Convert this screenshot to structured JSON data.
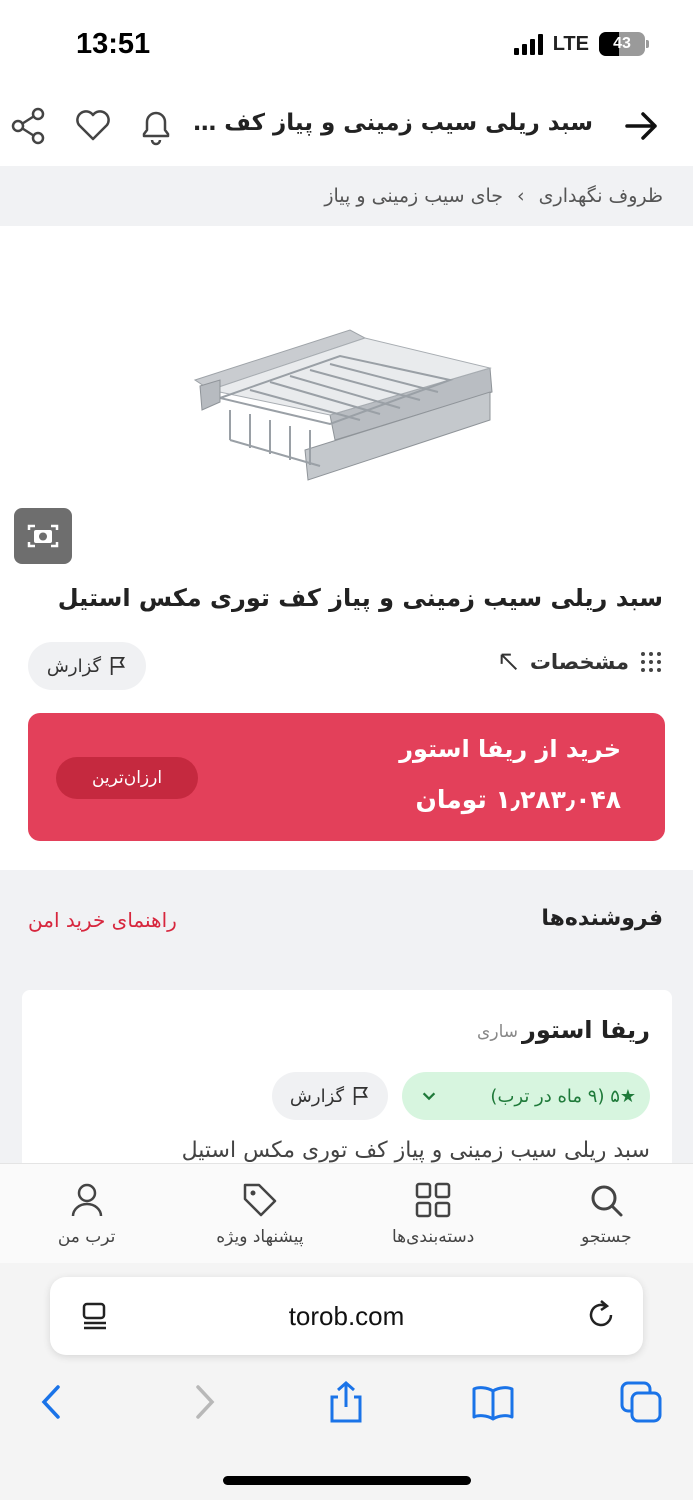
{
  "status": {
    "time": "13:51",
    "network": "LTE",
    "battery": "43"
  },
  "header": {
    "title": "سبد ریلی سیب زمینی و پیاز کف تور..."
  },
  "breadcrumb": {
    "items": [
      "ظروف نگهداری",
      "جای سیب زمینی و پیاز"
    ],
    "separator": "›"
  },
  "product": {
    "title": "سبد ریلی سیب زمینی و پیاز کف توری مکس استیل",
    "specs_label": "مشخصات",
    "report_label": "گزارش"
  },
  "buy": {
    "title": "خرید از ریفا استور",
    "price": "۱٫۲۸۳٫۰۴۸ تومان",
    "badge": "ارزان‌ترین",
    "color": "#e3405a"
  },
  "sellers": {
    "heading": "فروشنده‌ها",
    "guide": "راهنمای خرید امن",
    "list": [
      {
        "name": "ریفا استور",
        "city": "ساری",
        "rating": "★۵ (۹ ماه در ترب)",
        "report_label": "گزارش",
        "offer_title": "سبد ریلی سیب زمینی و پیاز کف توری مکس استیل"
      }
    ]
  },
  "bottom_nav": {
    "items": [
      {
        "label": "جستجو",
        "icon": "search-icon"
      },
      {
        "label": "دسته‌بندی‌ها",
        "icon": "grid-icon"
      },
      {
        "label": "پیشنهاد ویژه",
        "icon": "tag-icon"
      },
      {
        "label": "ترب من",
        "icon": "user-icon"
      }
    ]
  },
  "browser": {
    "url": "torob.com"
  }
}
